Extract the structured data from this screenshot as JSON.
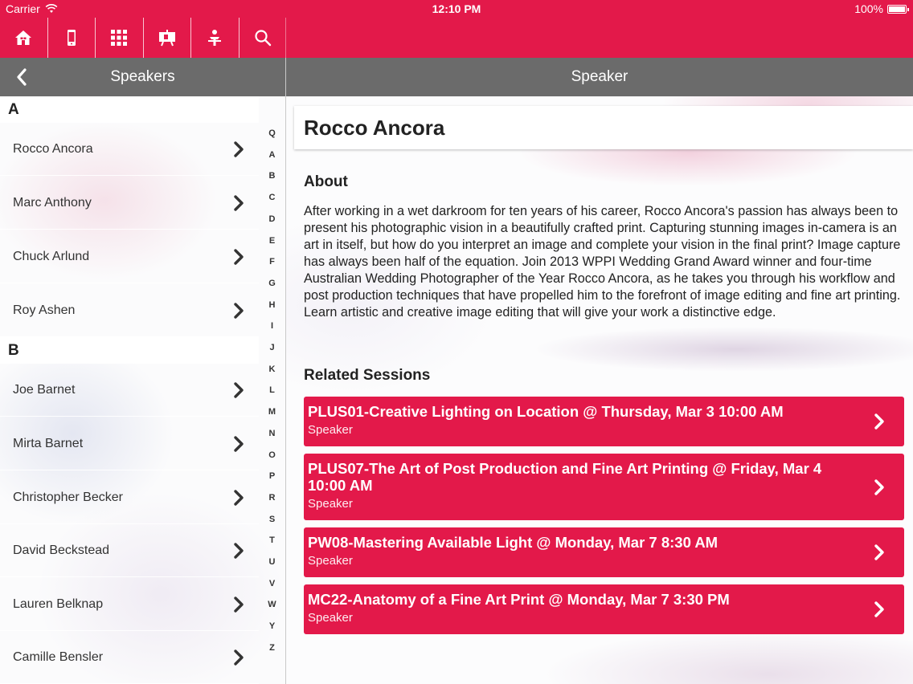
{
  "status_bar": {
    "carrier": "Carrier",
    "time": "12:10 PM",
    "battery": "100%"
  },
  "toolbar": {
    "icons": [
      "home-icon",
      "mobile-device-icon",
      "grid-icon",
      "presentation-board-icon",
      "speaker-person-icon",
      "search-icon"
    ]
  },
  "left_nav": {
    "title": "Speakers",
    "back_icon": "chevron-left-icon"
  },
  "right_nav": {
    "title": "Speaker"
  },
  "sections": [
    {
      "letter": "A",
      "speakers": [
        "Rocco Ancora",
        "Marc Anthony",
        "Chuck Arlund",
        "Roy Ashen"
      ]
    },
    {
      "letter": "B",
      "speakers": [
        "Joe Barnet",
        "Mirta Barnet",
        "Christopher Becker",
        "David Beckstead",
        "Lauren Belknap",
        "Camille Bensler"
      ]
    }
  ],
  "index_letters": [
    "Q",
    "A",
    "B",
    "C",
    "D",
    "E",
    "F",
    "G",
    "H",
    "I",
    "J",
    "K",
    "L",
    "M",
    "N",
    "O",
    "P",
    "R",
    "S",
    "T",
    "U",
    "V",
    "W",
    "Y",
    "Z"
  ],
  "speaker": {
    "name": "Rocco Ancora",
    "about_heading": "About",
    "about_text": "After working in a wet darkroom for ten years of his career, Rocco Ancora's passion has always been to present his photographic vision in a beautifully crafted print. Capturing stunning images in-camera is an art in itself, but how do you interpret an image and complete your vision in the final print? Image capture has always been half of the equation. Join 2013 WPPI Wedding Grand Award winner and four-time Australian Wedding Photographer of the Year Rocco Ancora, as he takes you through his workflow and post production techniques that have propelled him to the forefront of image editing and fine art printing. Learn artistic and creative image editing that will give your work a distinctive edge.",
    "related_heading": "Related Sessions",
    "sessions": [
      {
        "title": "PLUS01-Creative Lighting on Location @ Thursday, Mar 3 10:00 AM",
        "role": "Speaker"
      },
      {
        "title": "PLUS07-The Art of Post Production and Fine Art Printing @ Friday, Mar 4 10:00 AM",
        "role": "Speaker"
      },
      {
        "title": "PW08-Mastering Available Light @ Monday, Mar 7 8:30 AM",
        "role": "Speaker"
      },
      {
        "title": "MC22-Anatomy of a Fine Art Print @ Monday, Mar 7 3:30 PM",
        "role": "Speaker"
      }
    ]
  },
  "colors": {
    "brand": "#e3194a",
    "nav_bar": "#6b6b6b"
  }
}
